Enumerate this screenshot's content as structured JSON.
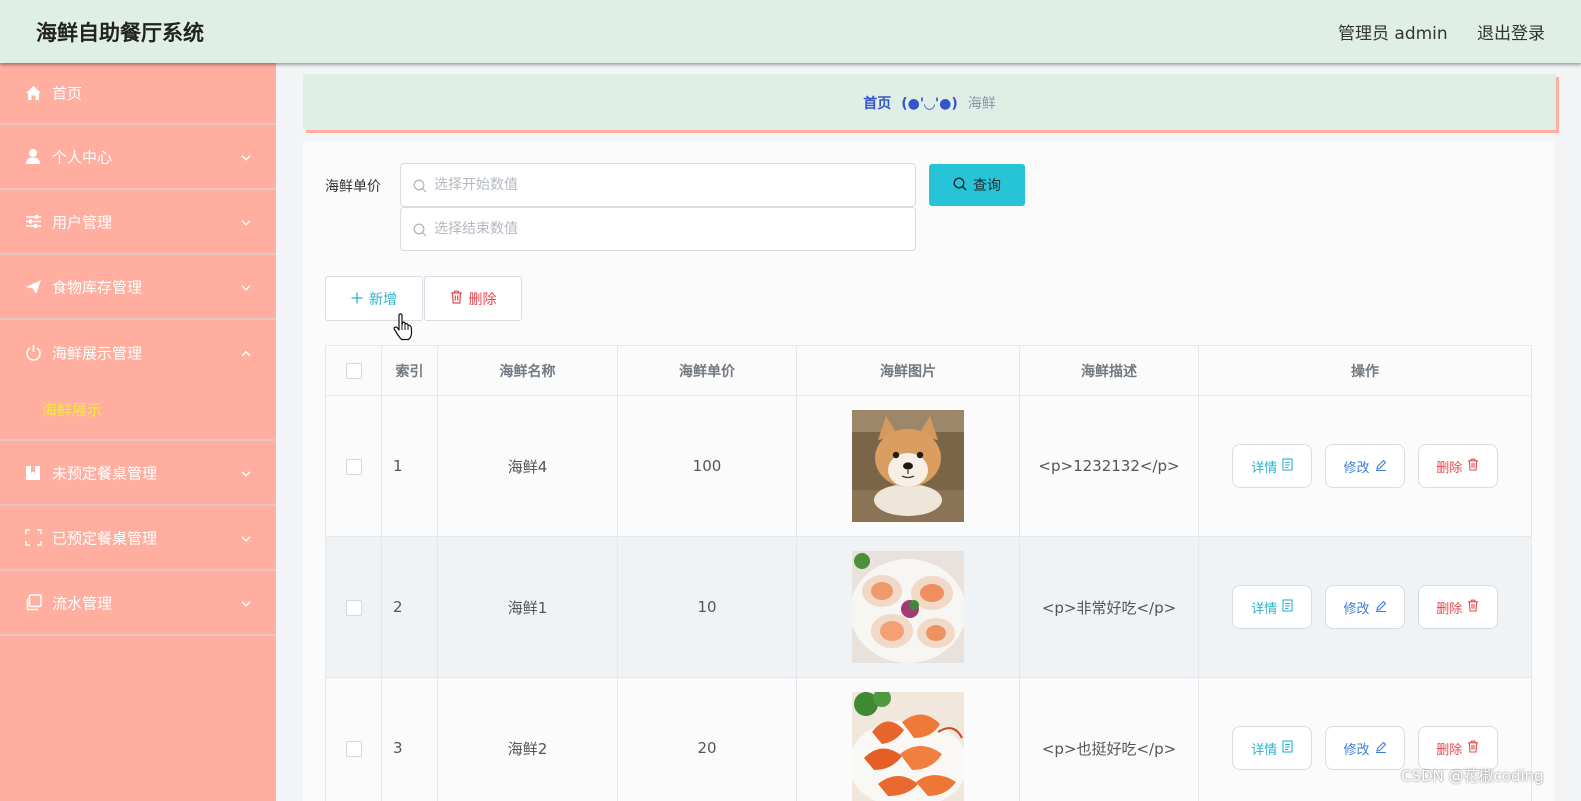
{
  "header": {
    "app_title": "海鲜自助餐厅系统",
    "user_info": "管理员 admin",
    "logout_label": "退出登录"
  },
  "sidebar": {
    "home_label": "首页",
    "items": [
      {
        "label": "个人中心",
        "icon": "person-icon",
        "expanded": false
      },
      {
        "label": "用户管理",
        "icon": "sliders-icon",
        "expanded": false
      },
      {
        "label": "食物库存管理",
        "icon": "send-icon",
        "expanded": false
      },
      {
        "label": "海鲜展示管理",
        "icon": "power-icon",
        "expanded": true
      },
      {
        "label": "未预定餐桌管理",
        "icon": "book-icon",
        "expanded": false
      },
      {
        "label": "已预定餐桌管理",
        "icon": "frame-icon",
        "expanded": false
      },
      {
        "label": "流水管理",
        "icon": "copy-icon",
        "expanded": false
      }
    ],
    "active_subitem_label": "海鲜展示"
  },
  "breadcrumb": {
    "home": "首页",
    "separator": "(●'◡'●)",
    "current": "海鲜"
  },
  "search": {
    "label": "海鲜单价",
    "start_placeholder": "选择开始数值",
    "end_placeholder": "选择结束数值",
    "query_label": "查询"
  },
  "toolbar": {
    "add_label": "新增",
    "delete_label": "删除"
  },
  "table": {
    "columns": [
      "索引",
      "海鲜名称",
      "海鲜单价",
      "海鲜图片",
      "海鲜描述",
      "操作"
    ],
    "rows": [
      {
        "index": "1",
        "name": "海鲜4",
        "price": "100",
        "image": "shiba-dog-photo",
        "description": "<p>1232132</p>"
      },
      {
        "index": "2",
        "name": "海鲜1",
        "price": "10",
        "image": "scallop-plate-photo",
        "description": "<p>非常好吃</p>"
      },
      {
        "index": "3",
        "name": "海鲜2",
        "price": "20",
        "image": "shrimp-plate-photo",
        "description": "<p>也挺好吃</p>"
      }
    ],
    "actions": {
      "detail": "详情",
      "edit": "修改",
      "delete": "删除"
    }
  },
  "watermark": "CSDN @花椒coding",
  "colors": {
    "header_bg": "#dfefe6",
    "sidebar_bg": "#ffaea0",
    "active_submenu": "#f5e93c",
    "primary": "#26c4d6",
    "danger": "#e5484d"
  }
}
